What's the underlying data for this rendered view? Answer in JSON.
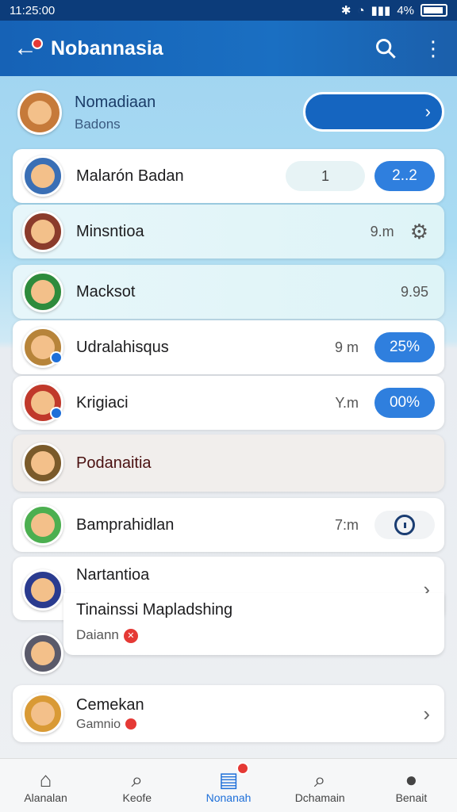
{
  "status_bar": {
    "time": "11:25:00",
    "battery": "4%"
  },
  "app_bar": {
    "title": "Nobannasia"
  },
  "header": {
    "name": "Nomadiaan",
    "sub": "Badons"
  },
  "rows": [
    {
      "name": "Malarón Badan",
      "pill_light": "1",
      "pill_blue": "2..2",
      "avatar_color": "#3a6fb5"
    },
    {
      "name": "Minsntioa",
      "meta": "9.m",
      "avatar_color": "#8b3b2b"
    },
    {
      "name": "Macksot",
      "meta": "9.95",
      "avatar_color": "#2e8b3c"
    },
    {
      "name": "Udralahisqus",
      "meta": "9 m",
      "pill_blue": "25%",
      "avatar_color": "#b7843a"
    },
    {
      "name": "Krigiaci",
      "meta": "Y.m",
      "pill_blue": "00%",
      "avatar_color": "#c0392b"
    },
    {
      "name": "Podanaitia",
      "avatar_color": "#7a5a2a"
    },
    {
      "name": "Bamprahidlan",
      "meta": "7:m",
      "avatar_color": "#4caf50"
    }
  ],
  "expanded_card": {
    "title": "Nartantioa",
    "subtitle": "Tinainssi Mapladshing",
    "footer": "Daiann"
  },
  "bottom_row": {
    "name": "Cemekan",
    "sub": "Gamnio"
  },
  "nav": [
    {
      "label": "Alanalan",
      "icon": "home-icon"
    },
    {
      "label": "Keofe",
      "icon": "search-icon"
    },
    {
      "label": "Nonanah",
      "icon": "chat-icon",
      "active": true
    },
    {
      "label": "Dchamain",
      "icon": "search-icon"
    },
    {
      "label": "Benait",
      "icon": "profile-icon"
    }
  ]
}
